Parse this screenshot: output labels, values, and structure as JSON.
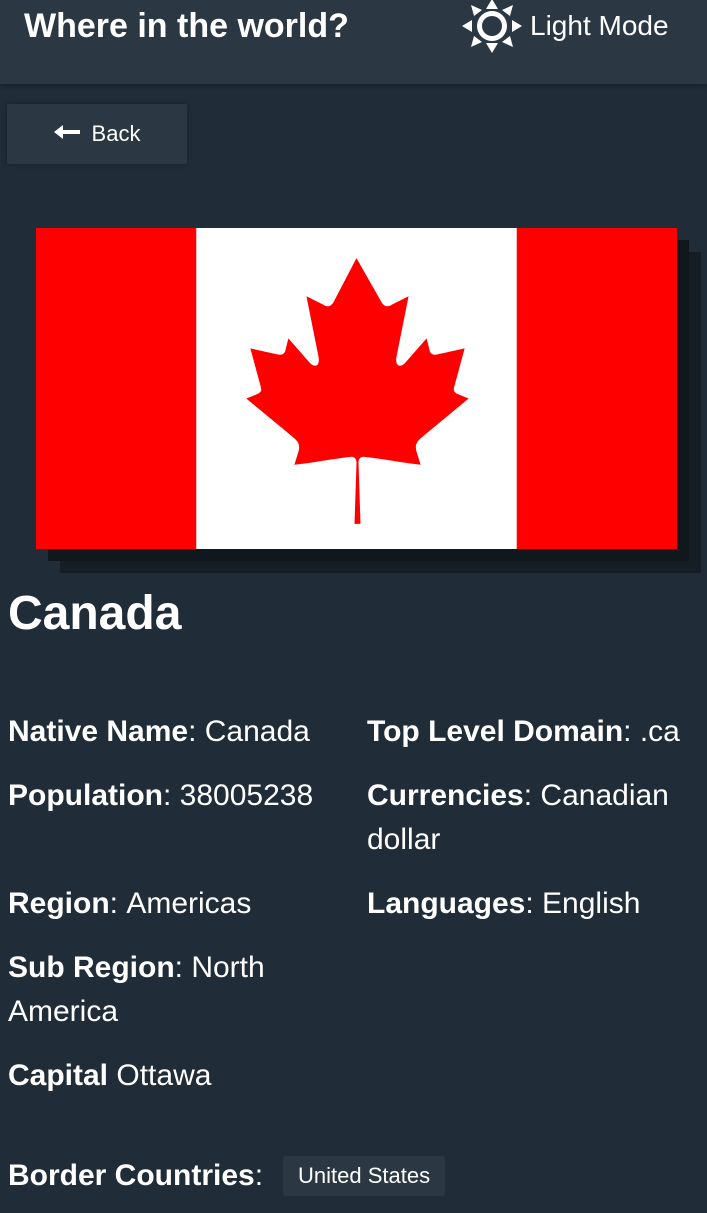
{
  "header": {
    "title": "Where in the world?",
    "mode_label": "Light Mode",
    "mode_icon": "sun-icon"
  },
  "back": {
    "label": "Back",
    "icon": "arrow-left-icon"
  },
  "country": {
    "name": "Canada",
    "flag": {
      "description_icon": "canada-flag",
      "colors": {
        "red": "#ff0000",
        "white": "#ffffff"
      }
    },
    "details": {
      "native_name_label": "Native Name",
      "native_name": "Canada",
      "population_label": "Population",
      "population": "38005238",
      "region_label": "Region",
      "region": "Americas",
      "sub_region_label": "Sub Region",
      "sub_region": "North America",
      "capital_label": "Capital",
      "capital": "Ottawa",
      "tld_label": "Top Level Domain",
      "tld": ".ca",
      "currencies_label": "Currencies",
      "currencies": "Canadian dollar",
      "languages_label": "Languages",
      "languages": "English"
    },
    "border_label": "Border Countries",
    "borders": [
      "United States"
    ]
  },
  "theme": {
    "background": "#202c37",
    "elements": "#2b3743",
    "text": "#ffffff"
  }
}
